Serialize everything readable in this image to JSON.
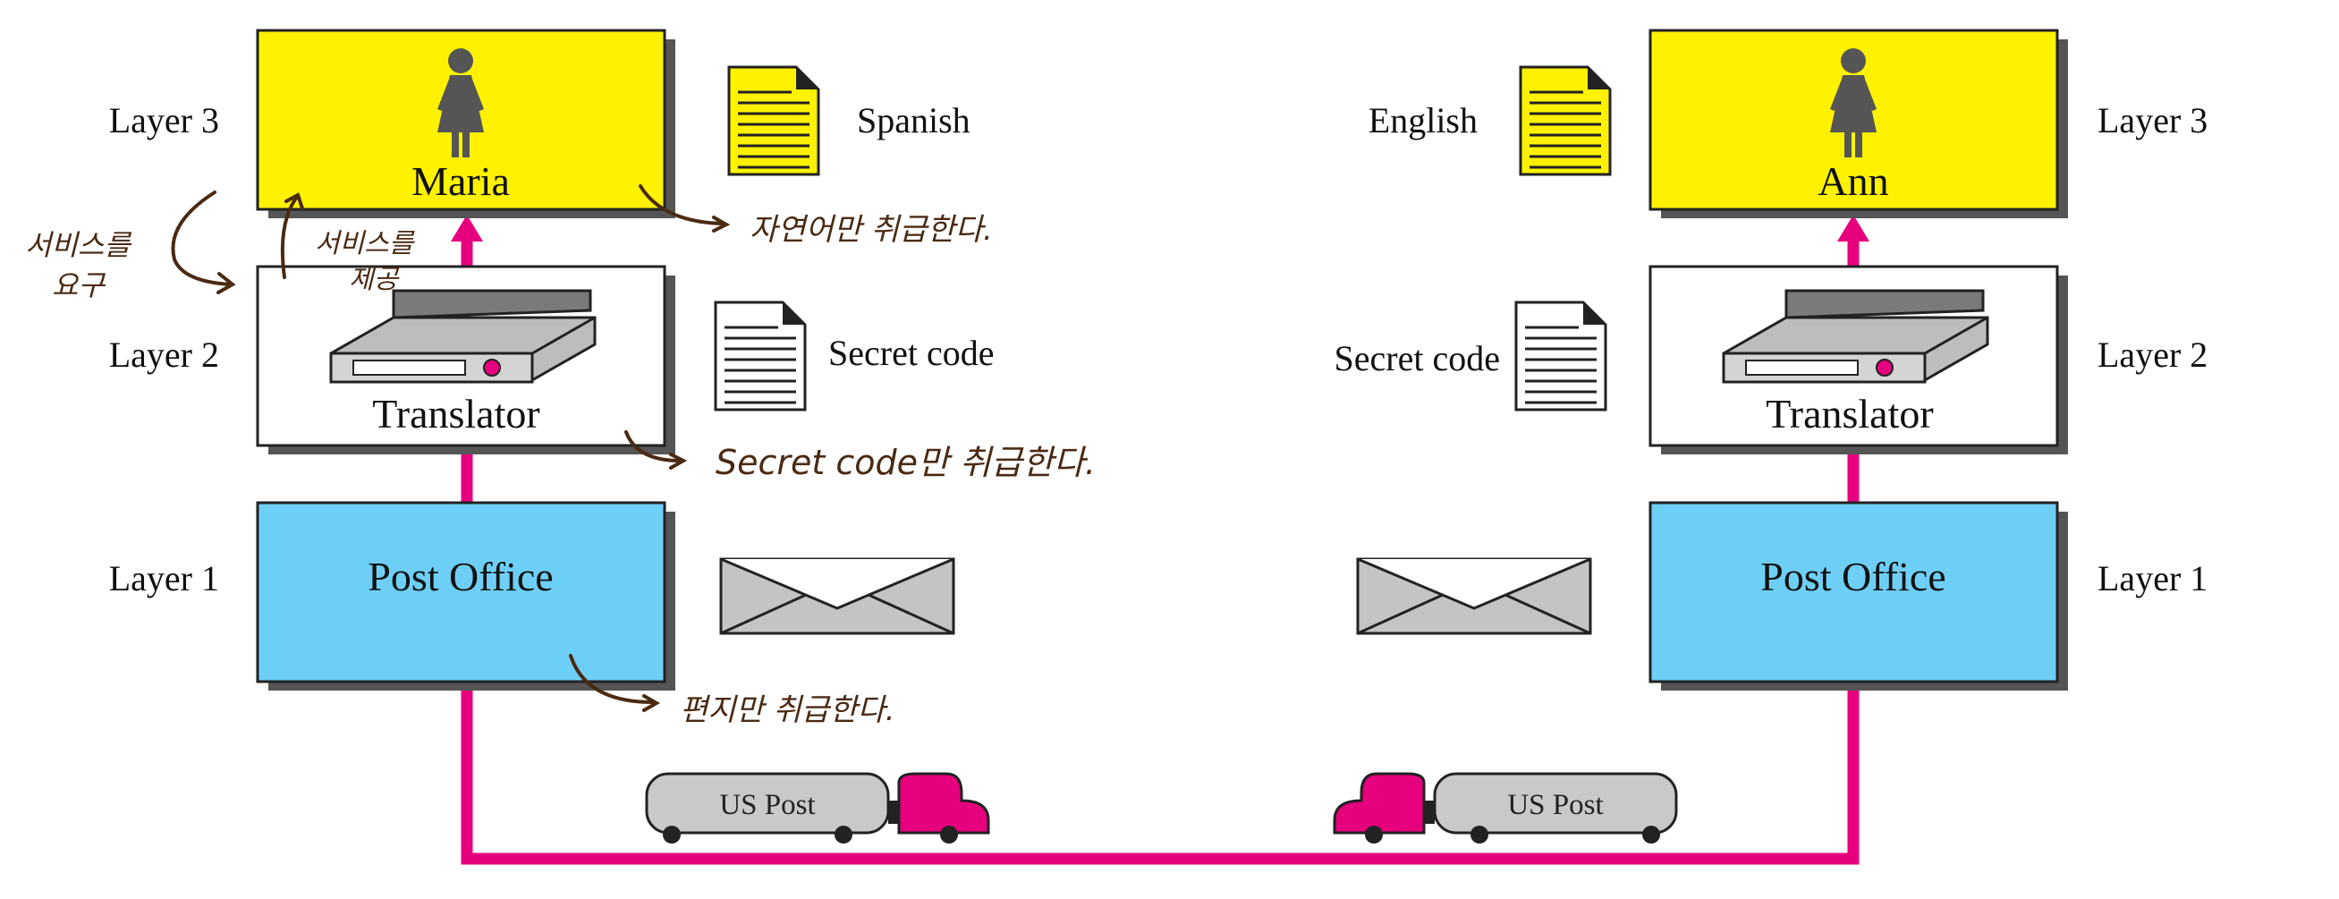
{
  "colors": {
    "accent_line": "#e6007e",
    "layer3_box": "#fff200",
    "layer1_box": "#6ecff6",
    "layer2_box": "#ffffff",
    "shadow": "#555555",
    "vehicle_body": "#c9c9c9",
    "cab": "#e6007e",
    "handwriting": "#4a2a12"
  },
  "left": {
    "layer3": {
      "label": "Layer 3",
      "person": "Maria",
      "doc_label": "Spanish"
    },
    "layer2": {
      "label": "Layer 2",
      "box": "Translator",
      "doc_label": "Secret code"
    },
    "layer1": {
      "label": "Layer 1",
      "box": "Post Office"
    },
    "truck": "US Post"
  },
  "right": {
    "layer3": {
      "label": "Layer 3",
      "person": "Ann",
      "doc_label": "English"
    },
    "layer2": {
      "label": "Layer 2",
      "box": "Translator",
      "doc_label": "Secret code"
    },
    "layer1": {
      "label": "Layer 1",
      "box": "Post Office"
    },
    "truck": "US Post"
  },
  "annotations": {
    "request_service": [
      "서비스를",
      "요구"
    ],
    "provide_service": [
      "서비스를",
      "제공"
    ],
    "layer3_note": "자연어만 취급한다.",
    "layer2_note": "Secret code만 취급한다.",
    "layer1_note": "편지만 취급한다."
  },
  "icons": [
    "person-icon",
    "document-icon",
    "scanner-icon",
    "envelope-icon",
    "truck-icon"
  ]
}
